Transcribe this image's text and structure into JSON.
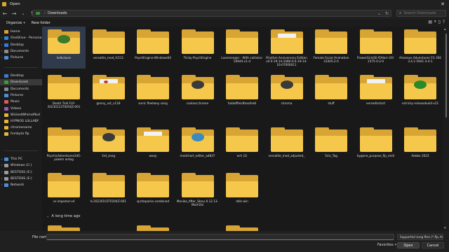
{
  "window": {
    "title": "Open"
  },
  "nav": {
    "back": "←",
    "forward": "→",
    "down": "⌄",
    "up": "↑"
  },
  "address": {
    "path": [
      "Downloads"
    ],
    "separator": "›"
  },
  "search": {
    "placeholder": "Search Downloads"
  },
  "toolbar": {
    "organize": "Organize",
    "new_folder": "New folder"
  },
  "sidebar": {
    "items": [
      {
        "label": "Home",
        "icon": "home-icon",
        "color": "#e0a030",
        "arrow": ""
      },
      {
        "label": "OneDrive - Persona",
        "icon": "cloud-icon",
        "color": "#2e86de",
        "arrow": "›"
      },
      {
        "label": "Desktop",
        "icon": "desktop-icon",
        "color": "#3a7bd5",
        "arrow": "›"
      },
      {
        "label": "Documents",
        "icon": "documents-icon",
        "color": "#8a8a8a",
        "arrow": "›"
      },
      {
        "label": "Pictures",
        "icon": "pictures-icon",
        "color": "#4a90d9",
        "arrow": "›"
      },
      {
        "label": "Desktop",
        "icon": "desktop-icon",
        "color": "#3a7bd5",
        "arrow": ""
      },
      {
        "label": "Downloads",
        "icon": "downloads-icon",
        "color": "#3c9a3c",
        "arrow": "",
        "selected": true
      },
      {
        "label": "Documents",
        "icon": "documents-icon",
        "color": "#8a8a8a",
        "arrow": ""
      },
      {
        "label": "Pictures",
        "icon": "pictures-icon",
        "color": "#4a90d9",
        "arrow": ""
      },
      {
        "label": "Music",
        "icon": "music-icon",
        "color": "#e05a5a",
        "arrow": ""
      },
      {
        "label": "Videos",
        "icon": "videos-icon",
        "color": "#9b59b6",
        "arrow": ""
      },
      {
        "label": "WickedWhimsMod",
        "icon": "folder-icon",
        "color": "#e6b53b",
        "arrow": ""
      },
      {
        "label": "HYPNOS LULLABY",
        "icon": "folder-icon",
        "color": "#e6b53b",
        "arrow": ""
      },
      {
        "label": "chromename",
        "icon": "folder-icon",
        "color": "#e6b53b",
        "arrow": ""
      },
      {
        "label": "fnmbyte flp",
        "icon": "folder-icon",
        "color": "#e6b53b",
        "arrow": ""
      },
      {
        "label": "This PC",
        "icon": "computer-icon",
        "color": "#4a90d9",
        "arrow": "⌄"
      },
      {
        "label": "Windows (C:)",
        "icon": "drive-icon",
        "color": "#9a9a9a",
        "arrow": "›"
      },
      {
        "label": "BESTOSS (E:)",
        "icon": "drive-icon",
        "color": "#9a9a9a",
        "arrow": "›"
      },
      {
        "label": "BESTOSS (E:)",
        "icon": "drive-icon",
        "color": "#9a9a9a",
        "arrow": "›"
      },
      {
        "label": "Network",
        "icon": "network-icon",
        "color": "#4a90d9",
        "arrow": "›"
      }
    ]
  },
  "files": [
    {
      "name": "helkckasn",
      "art": "#3a7a2a",
      "selected": true
    },
    {
      "name": "versatile_mod_fc511",
      "art": ""
    },
    {
      "name": "PsychEngine-Windows64",
      "art": ""
    },
    {
      "name": "Tricky-PsychEngine",
      "art": ""
    },
    {
      "name": "Lovemonger - With collision-54944-v1-4",
      "art": ""
    },
    {
      "name": "Rhythm Anniversary Edition v0-4-19-14-1080-0-4-19-14-16-07000011",
      "art": "paper"
    },
    {
      "name": "Female Facial Animation 33305-2-0",
      "art": ""
    },
    {
      "name": "FlowerGirlsSE-fOHair-r20-1575-0-2-0",
      "art": ""
    },
    {
      "name": "Amorous Adventures FG 3SE 3.4.1-5941-3-4-1",
      "art": ""
    },
    {
      "name": "Death Troll FLP-20230123T0056Z-001",
      "art": ""
    },
    {
      "name": "genny_vst_v118",
      "art": "paper-red"
    },
    {
      "name": "sonic fleetway song",
      "art": ""
    },
    {
      "name": "coolascchrome",
      "art": "#3a3a3a"
    },
    {
      "name": "fadadffesdfeasfedd",
      "art": ""
    },
    {
      "name": "chroma",
      "art": "#3a3a3a"
    },
    {
      "name": "stuff",
      "art": ""
    },
    {
      "name": "versedlartart",
      "art": "paper"
    },
    {
      "name": "vstricky-releasebuild-v21",
      "art": "#2a8a2a"
    },
    {
      "name": "PsychicAdventures3d5-pokem ontog",
      "art": ""
    },
    {
      "name": "3rd_song",
      "art": "#3a3a3a"
    },
    {
      "name": "wooy",
      "art": "paper"
    },
    {
      "name": "modchart_editor_ad837",
      "art": "#3a8ac0"
    },
    {
      "name": "ech (2)",
      "art": ""
    },
    {
      "name": "versatile_mod_adjusted_",
      "art": ""
    },
    {
      "name": "5nis_Tag",
      "art": ""
    },
    {
      "name": "bygone_purpose_flp_midi",
      "art": ""
    },
    {
      "name": "Adobe 2022",
      "art": ""
    },
    {
      "name": "vs-impostor-v4",
      "art": ""
    },
    {
      "name": "b-20230103T0204Z-001",
      "art": ""
    },
    {
      "name": "spritepacks-combined",
      "art": ""
    },
    {
      "name": "Monika_After_Story-0.12.13-Mod-Dis",
      "art": ""
    },
    {
      "name": "ddlc-win",
      "art": ""
    }
  ],
  "group": {
    "label": "A long time ago",
    "chevron": "⌄"
  },
  "footer": {
    "file_name_label": "File name:",
    "file_name_value": "",
    "file_type": "Supported song files (*.flp, *z",
    "favorites": "Favorites",
    "open": "Open",
    "cancel": "Cancel"
  }
}
